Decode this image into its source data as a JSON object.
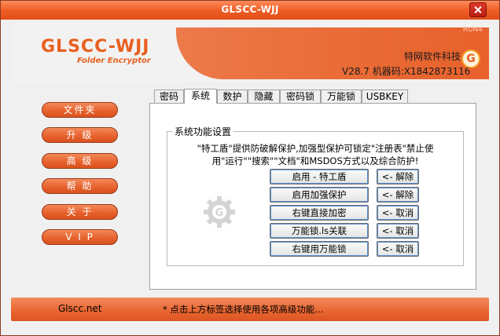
{
  "window": {
    "title": "GLSCC-WJJ"
  },
  "header": {
    "logo_text": "GLSCC-WJJ",
    "logo_subtitle": "Folder Encryptor",
    "ver_tag": "RUN4",
    "company": "特网软件科技",
    "version_line": "V28.7   机器码:X1842873116",
    "badge_letter": "G"
  },
  "nav": {
    "items": [
      {
        "label": "文件夹"
      },
      {
        "label": "升  级"
      },
      {
        "label": "高  级"
      },
      {
        "label": "帮  助"
      },
      {
        "label": "关  于"
      },
      {
        "label": "V I P"
      }
    ]
  },
  "tabs": [
    {
      "label": "密码"
    },
    {
      "label": "系统"
    },
    {
      "label": "数护"
    },
    {
      "label": "隐藏"
    },
    {
      "label": "密码锁"
    },
    {
      "label": "万能锁"
    },
    {
      "label": "USBKEY"
    }
  ],
  "active_tab": "系统",
  "system": {
    "group_title": "系统功能设置",
    "description": "\"特工盾\"提供防破解保护,加强型保护可锁定\"注册表\"禁止使用\"运行\"\"搜索\"\"文档\"和MSDOS方式以及综合防护!",
    "rows": [
      {
        "action": "启用 - 特工盾",
        "undo": "<- 解除"
      },
      {
        "action": "启用加强保护",
        "undo": "<- 解除"
      },
      {
        "action": "右键直接加密",
        "undo": "<- 取消"
      },
      {
        "action": "万能锁.ls关联",
        "undo": "<- 取消"
      },
      {
        "action": "右键用万能锁",
        "undo": "<- 取消"
      }
    ]
  },
  "footer": {
    "site": "Glscc.net",
    "hint": "* 点击上方标签选择使用各项高级功能..."
  },
  "colors": {
    "accent": "#e8622d",
    "accent_dark": "#9a3a18",
    "title_bar": "#ee5a22"
  }
}
